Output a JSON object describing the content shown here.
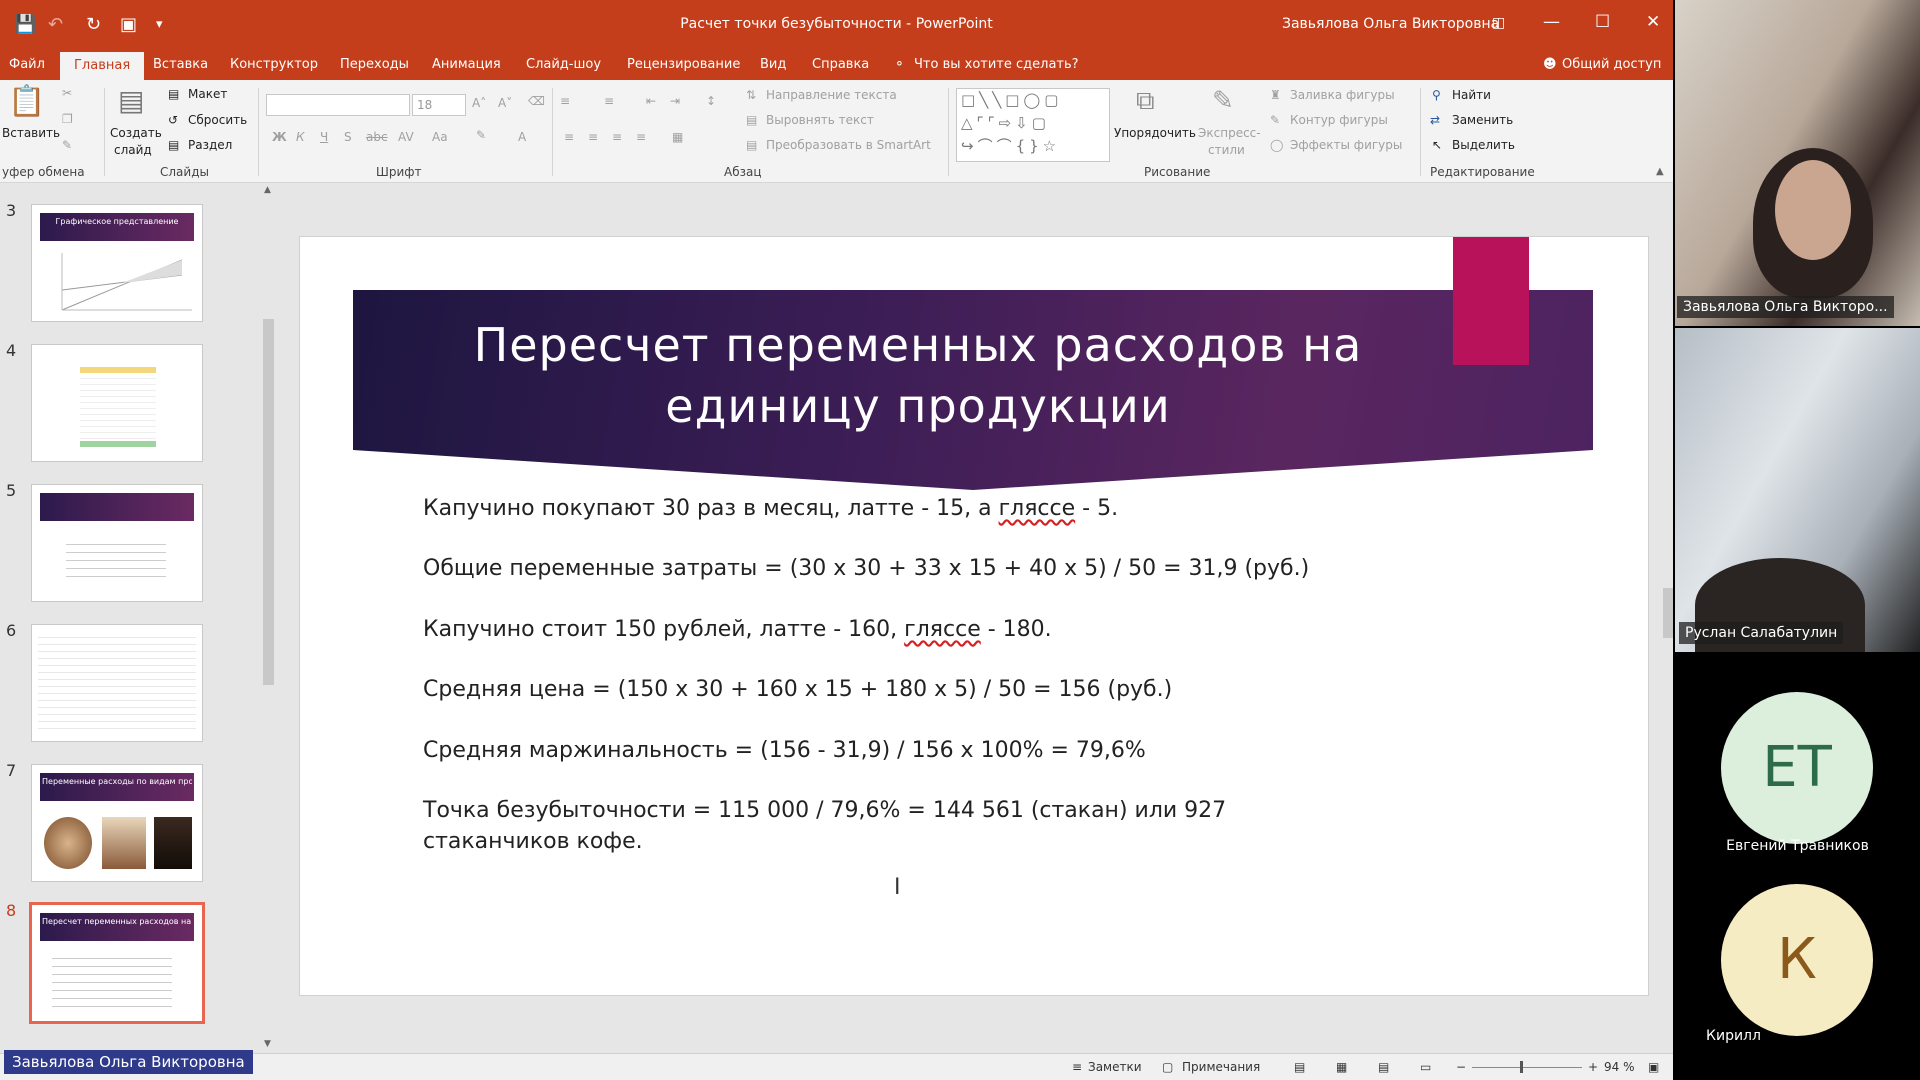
{
  "app": {
    "window_title": "Расчет точки безубыточности - PowerPoint",
    "user_name": "Завьялова Ольга Викторовна",
    "qa_icons": [
      "save-icon",
      "undo-icon",
      "redo-icon",
      "present-icon",
      "customize-icon"
    ],
    "window_buttons": [
      "ribbon-display-icon",
      "minimize-icon",
      "maximize-icon",
      "close-icon"
    ]
  },
  "tabs": [
    "Файл",
    "Главная",
    "Вставка",
    "Конструктор",
    "Переходы",
    "Анимация",
    "Слайд-шоу",
    "Рецензирование",
    "Вид",
    "Справка"
  ],
  "tell_me": "Что вы хотите сделать?",
  "share": "Общий доступ",
  "ribbon": {
    "clipboard": {
      "paste": "Вставить",
      "group": "уфер обмена"
    },
    "slides": {
      "new_slide": "Создать",
      "new_slide2": "слайд",
      "layout": "Макет",
      "reset": "Сбросить",
      "section": "Раздел",
      "group": "Слайды"
    },
    "font": {
      "size": "18",
      "group": "Шрифт"
    },
    "paragraph": {
      "text_direction": "Направление текста",
      "align_text": "Выровнять текст",
      "smartart": "Преобразовать в SmartArt",
      "group": "Абзац"
    },
    "drawing": {
      "arrange": "Упорядочить",
      "quick_styles": "Экспресс-",
      "quick_styles2": "стили",
      "fill": "Заливка фигуры",
      "outline": "Контур фигуры",
      "effects": "Эффекты фигуры",
      "group": "Рисование"
    },
    "editing": {
      "find": "Найти",
      "replace": "Заменить",
      "select": "Выделить",
      "group": "Редактирование"
    }
  },
  "thumbs": [
    {
      "num": "3",
      "title": "Графическое представление"
    },
    {
      "num": "4",
      "title": ""
    },
    {
      "num": "5",
      "title": ""
    },
    {
      "num": "6",
      "title": ""
    },
    {
      "num": "7",
      "title": "Переменные расходы по видам продукции"
    },
    {
      "num": "8",
      "title": "Пересчет переменных расходов на единицу продукции"
    }
  ],
  "slide": {
    "title_line1": "Пересчет переменных расходов на",
    "title_line2": "единицу продукции",
    "line1a": "Капучино покупают 30 раз в месяц, латте -  15, а ",
    "line1b": "глясcе",
    "line1c": " -  5.",
    "line2": "Общие переменные затраты = (30 х 30 + 33 х 15 + 40 х 5) / 50 = 31,9 (руб.)",
    "line3a": "Капучино стоит 150 рублей, латте - 160, ",
    "line3b": "глясcе",
    "line3c": " - 180.",
    "line4": "Средняя цена = (150 х 30 + 160 х 15 + 180 х 5) / 50 = 156 (руб.)",
    "line5": "Средняя маржинальность = (156 - 31,9) / 156 х 100% = 79,6%",
    "line6": "Точка безубыточности = 115 000 / 79,6% = 144 561 (стакан) или 927",
    "line7": "стаканчиков кофе."
  },
  "status": {
    "notes": "Заметки",
    "comments": "Примечания",
    "zoom": "94 %"
  },
  "presenter_tag": "Завьялова Ольга Викторовна",
  "participants": [
    {
      "name": "Завьялова Ольга Викторо..."
    },
    {
      "name": "Руслан Салабатулин"
    },
    {
      "name": "Евгений Травников",
      "initials": "ЕТ",
      "color": "#dcefdc",
      "text_color": "#2e6b4a"
    },
    {
      "name": "Кирилл",
      "initials": "К",
      "color": "#f6ecc4",
      "text_color": "#8b5a1a"
    }
  ]
}
